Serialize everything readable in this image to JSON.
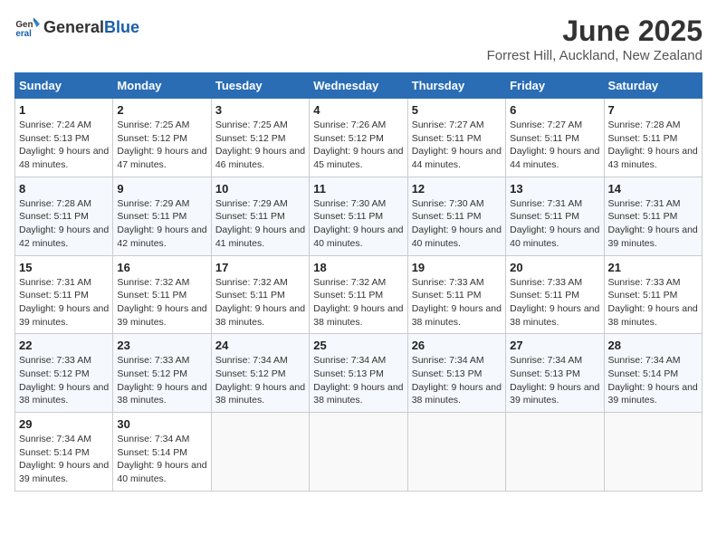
{
  "logo": {
    "general": "General",
    "blue": "Blue"
  },
  "title": "June 2025",
  "subtitle": "Forrest Hill, Auckland, New Zealand",
  "weekdays": [
    "Sunday",
    "Monday",
    "Tuesday",
    "Wednesday",
    "Thursday",
    "Friday",
    "Saturday"
  ],
  "weeks": [
    [
      {
        "day": "1",
        "sunrise": "Sunrise: 7:24 AM",
        "sunset": "Sunset: 5:13 PM",
        "daylight": "Daylight: 9 hours and 48 minutes."
      },
      {
        "day": "2",
        "sunrise": "Sunrise: 7:25 AM",
        "sunset": "Sunset: 5:12 PM",
        "daylight": "Daylight: 9 hours and 47 minutes."
      },
      {
        "day": "3",
        "sunrise": "Sunrise: 7:25 AM",
        "sunset": "Sunset: 5:12 PM",
        "daylight": "Daylight: 9 hours and 46 minutes."
      },
      {
        "day": "4",
        "sunrise": "Sunrise: 7:26 AM",
        "sunset": "Sunset: 5:12 PM",
        "daylight": "Daylight: 9 hours and 45 minutes."
      },
      {
        "day": "5",
        "sunrise": "Sunrise: 7:27 AM",
        "sunset": "Sunset: 5:11 PM",
        "daylight": "Daylight: 9 hours and 44 minutes."
      },
      {
        "day": "6",
        "sunrise": "Sunrise: 7:27 AM",
        "sunset": "Sunset: 5:11 PM",
        "daylight": "Daylight: 9 hours and 44 minutes."
      },
      {
        "day": "7",
        "sunrise": "Sunrise: 7:28 AM",
        "sunset": "Sunset: 5:11 PM",
        "daylight": "Daylight: 9 hours and 43 minutes."
      }
    ],
    [
      {
        "day": "8",
        "sunrise": "Sunrise: 7:28 AM",
        "sunset": "Sunset: 5:11 PM",
        "daylight": "Daylight: 9 hours and 42 minutes."
      },
      {
        "day": "9",
        "sunrise": "Sunrise: 7:29 AM",
        "sunset": "Sunset: 5:11 PM",
        "daylight": "Daylight: 9 hours and 42 minutes."
      },
      {
        "day": "10",
        "sunrise": "Sunrise: 7:29 AM",
        "sunset": "Sunset: 5:11 PM",
        "daylight": "Daylight: 9 hours and 41 minutes."
      },
      {
        "day": "11",
        "sunrise": "Sunrise: 7:30 AM",
        "sunset": "Sunset: 5:11 PM",
        "daylight": "Daylight: 9 hours and 40 minutes."
      },
      {
        "day": "12",
        "sunrise": "Sunrise: 7:30 AM",
        "sunset": "Sunset: 5:11 PM",
        "daylight": "Daylight: 9 hours and 40 minutes."
      },
      {
        "day": "13",
        "sunrise": "Sunrise: 7:31 AM",
        "sunset": "Sunset: 5:11 PM",
        "daylight": "Daylight: 9 hours and 40 minutes."
      },
      {
        "day": "14",
        "sunrise": "Sunrise: 7:31 AM",
        "sunset": "Sunset: 5:11 PM",
        "daylight": "Daylight: 9 hours and 39 minutes."
      }
    ],
    [
      {
        "day": "15",
        "sunrise": "Sunrise: 7:31 AM",
        "sunset": "Sunset: 5:11 PM",
        "daylight": "Daylight: 9 hours and 39 minutes."
      },
      {
        "day": "16",
        "sunrise": "Sunrise: 7:32 AM",
        "sunset": "Sunset: 5:11 PM",
        "daylight": "Daylight: 9 hours and 39 minutes."
      },
      {
        "day": "17",
        "sunrise": "Sunrise: 7:32 AM",
        "sunset": "Sunset: 5:11 PM",
        "daylight": "Daylight: 9 hours and 38 minutes."
      },
      {
        "day": "18",
        "sunrise": "Sunrise: 7:32 AM",
        "sunset": "Sunset: 5:11 PM",
        "daylight": "Daylight: 9 hours and 38 minutes."
      },
      {
        "day": "19",
        "sunrise": "Sunrise: 7:33 AM",
        "sunset": "Sunset: 5:11 PM",
        "daylight": "Daylight: 9 hours and 38 minutes."
      },
      {
        "day": "20",
        "sunrise": "Sunrise: 7:33 AM",
        "sunset": "Sunset: 5:11 PM",
        "daylight": "Daylight: 9 hours and 38 minutes."
      },
      {
        "day": "21",
        "sunrise": "Sunrise: 7:33 AM",
        "sunset": "Sunset: 5:11 PM",
        "daylight": "Daylight: 9 hours and 38 minutes."
      }
    ],
    [
      {
        "day": "22",
        "sunrise": "Sunrise: 7:33 AM",
        "sunset": "Sunset: 5:12 PM",
        "daylight": "Daylight: 9 hours and 38 minutes."
      },
      {
        "day": "23",
        "sunrise": "Sunrise: 7:33 AM",
        "sunset": "Sunset: 5:12 PM",
        "daylight": "Daylight: 9 hours and 38 minutes."
      },
      {
        "day": "24",
        "sunrise": "Sunrise: 7:34 AM",
        "sunset": "Sunset: 5:12 PM",
        "daylight": "Daylight: 9 hours and 38 minutes."
      },
      {
        "day": "25",
        "sunrise": "Sunrise: 7:34 AM",
        "sunset": "Sunset: 5:13 PM",
        "daylight": "Daylight: 9 hours and 38 minutes."
      },
      {
        "day": "26",
        "sunrise": "Sunrise: 7:34 AM",
        "sunset": "Sunset: 5:13 PM",
        "daylight": "Daylight: 9 hours and 38 minutes."
      },
      {
        "day": "27",
        "sunrise": "Sunrise: 7:34 AM",
        "sunset": "Sunset: 5:13 PM",
        "daylight": "Daylight: 9 hours and 39 minutes."
      },
      {
        "day": "28",
        "sunrise": "Sunrise: 7:34 AM",
        "sunset": "Sunset: 5:14 PM",
        "daylight": "Daylight: 9 hours and 39 minutes."
      }
    ],
    [
      {
        "day": "29",
        "sunrise": "Sunrise: 7:34 AM",
        "sunset": "Sunset: 5:14 PM",
        "daylight": "Daylight: 9 hours and 39 minutes."
      },
      {
        "day": "30",
        "sunrise": "Sunrise: 7:34 AM",
        "sunset": "Sunset: 5:14 PM",
        "daylight": "Daylight: 9 hours and 40 minutes."
      },
      null,
      null,
      null,
      null,
      null
    ]
  ]
}
